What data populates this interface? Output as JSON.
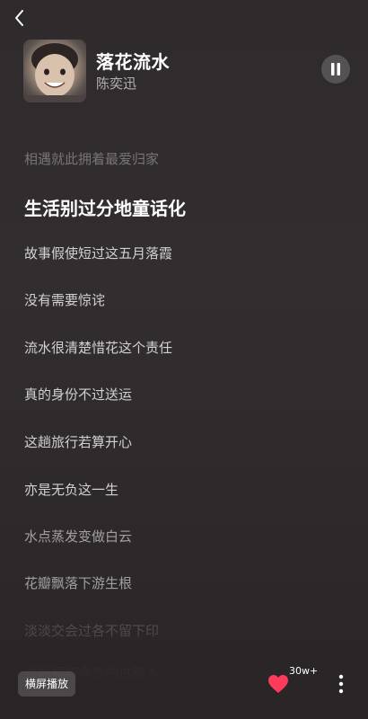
{
  "header": {
    "back_icon": "chevron-left-icon",
    "song_title": "落花流水",
    "artist": "陈奕迅",
    "pause_icon": "pause-icon"
  },
  "lyrics": {
    "lines": [
      "相遇就此拥着最爱归家",
      "生活别过分地童话化",
      "故事假使短过这五月落霞",
      "没有需要惊诧",
      "流水很清楚惜花这个责任",
      "真的身份不过送运",
      "这趟旅行若算开心",
      "亦是无负这一生",
      "水点蒸发变做白云",
      "花瓣飘落下游生根",
      "淡淡交会过各不留下印",
      "谁能预知今季的过路人"
    ],
    "current_index": 1
  },
  "footer": {
    "landscape_label": "横屏播放",
    "like_count": "30w+",
    "heart_icon": "heart-icon",
    "more_icon": "more-vertical-icon",
    "like_color": "#ff3b5c"
  }
}
